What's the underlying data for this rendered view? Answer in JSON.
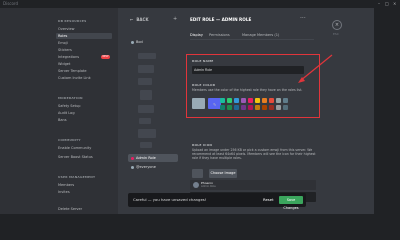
{
  "app": {
    "title": "Discord"
  },
  "sidebar": {
    "header": "DB RESOURCES",
    "items": [
      {
        "label": "Overview"
      },
      {
        "label": "Roles"
      },
      {
        "label": "Emoji"
      },
      {
        "label": "Stickers"
      },
      {
        "label": "Integrations",
        "badge": "NEW"
      },
      {
        "label": "Widget"
      },
      {
        "label": "Server Template"
      },
      {
        "label": "Custom Invite Link"
      }
    ],
    "moderation_header": "MODERATION",
    "moderation_items": [
      {
        "label": "Safety Setup"
      },
      {
        "label": "Audit Log"
      },
      {
        "label": "Bans"
      }
    ],
    "community_header": "COMMUNITY",
    "community_items": [
      {
        "label": "Enable Community"
      },
      {
        "label": "Server Boost Status"
      }
    ],
    "user_header": "USER MANAGEMENT",
    "user_items": [
      {
        "label": "Members"
      },
      {
        "label": "Invites"
      }
    ],
    "delete_label": "Delete Server"
  },
  "roles": {
    "back_label": "BACK",
    "add_icon": "plus-icon",
    "first_role": "Bod",
    "selected_role": "Admin Role",
    "everyone_role": "@everyone"
  },
  "editor": {
    "title": "EDIT ROLE — ADMIN ROLE",
    "more_icon": "ellipsis-icon",
    "tabs": [
      "Display",
      "Permissions",
      "Manage Members (1)"
    ],
    "role_name_label": "ROLE NAME",
    "role_name_value": "Admin Role",
    "role_color_label": "ROLE COLOR",
    "role_color_desc": "Members use the color of the highest role they have on the roles list.",
    "default_color": "#99aab5",
    "custom_color": "#5865f2",
    "palette_top": [
      "#1abc9c",
      "#2ecc71",
      "#3498db",
      "#9b59b6",
      "#e91e63",
      "#f1c40f",
      "#e67e22",
      "#e74c3c",
      "#95a5a6",
      "#607d8b"
    ],
    "palette_bottom": [
      "#11806a",
      "#1f8b4c",
      "#206694",
      "#71368a",
      "#ad1457",
      "#c27c0e",
      "#a84300",
      "#992d22",
      "#979c9f",
      "#546e7a"
    ],
    "role_icon_label": "ROLE ICON",
    "role_icon_desc": "Upload an image under 256 KB or pick a custom emoji from this server. We recommend at least 64x64 pixels. Members will see the icon for their highest role if they have multiple roles.",
    "choose_image_label": "Choose Image",
    "preview_name": "Phoenix",
    "preview_sub_1": "Admin Role",
    "preview_sub_2": "Admin Role"
  },
  "close": {
    "icon": "close-icon",
    "label": "ESC"
  },
  "savebar": {
    "message": "Careful — you have unsaved changes!",
    "reset_label": "Reset",
    "save_label": "Save Changes"
  }
}
